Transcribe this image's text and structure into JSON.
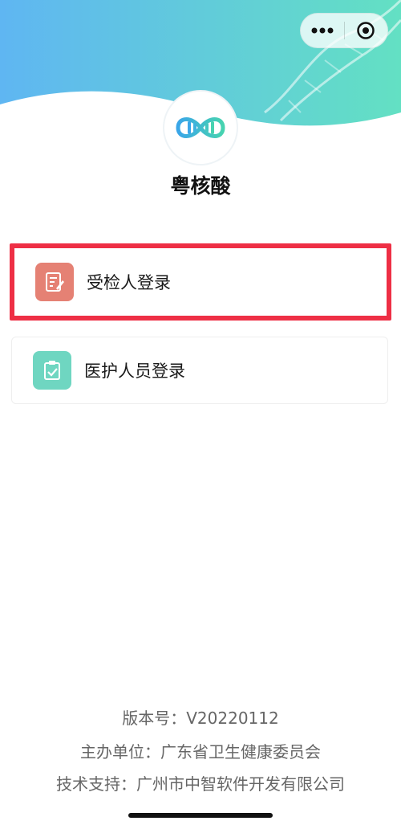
{
  "app": {
    "name": "粤核酸"
  },
  "colors": {
    "header_gradient_start": "#5fb6f2",
    "header_gradient_end": "#63e0c3",
    "highlight_border": "#ee2f45",
    "examinee_icon_bg": "#e58174",
    "staff_icon_bg": "#6fd6c1"
  },
  "icons": {
    "more": "dots-icon",
    "close": "target-close-icon",
    "logo": "dna-logo-icon",
    "examinee": "form-pen-icon",
    "staff": "clipboard-check-icon"
  },
  "login_options": [
    {
      "label": "受检人登录"
    },
    {
      "label": "医护人员登录"
    }
  ],
  "footer": {
    "version": "版本号：V20220112",
    "sponsor": "主办单位：广东省卫生健康委员会",
    "tech_support": "技术支持：广州市中智软件开发有限公司"
  }
}
